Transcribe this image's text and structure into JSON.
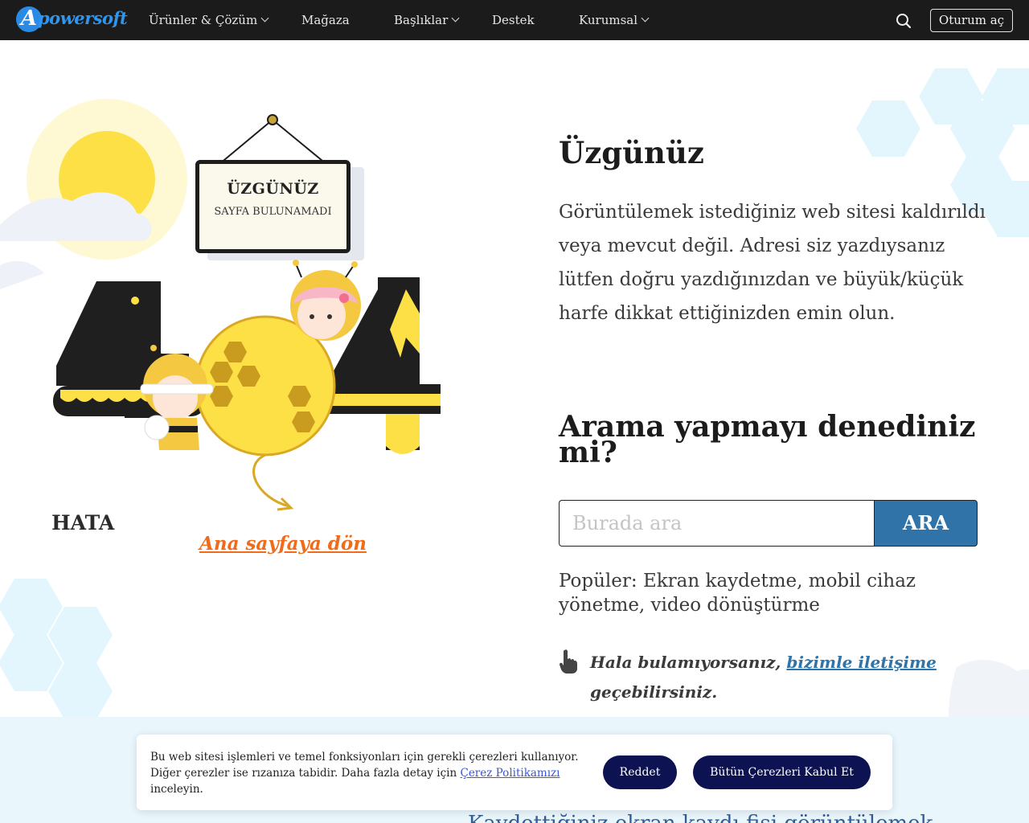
{
  "nav": {
    "logo_text": "powersoft",
    "logo_letter": "A",
    "items": [
      {
        "label": "Ürünler & Çözüm"
      },
      {
        "label": "Mağaza"
      },
      {
        "label": "Başlıklar"
      },
      {
        "label": "Destek"
      },
      {
        "label": "Kurumsal"
      }
    ],
    "login_label": "Oturum aç"
  },
  "illustration": {
    "sign_title": "ÜZGÜNÜZ",
    "sign_subtitle": "SAYFA BULUNAMADI",
    "error_label": "HATA",
    "home_link": "Ana sayfaya dön"
  },
  "main": {
    "sorry_heading": "Üzgünüz",
    "sorry_text": "Görüntülemek istediğiniz web sitesi kaldırıldı veya mevcut değil. Adresi siz yazdıysanız lütfen doğru yazdığınızdan ve büyük/küçük harfe dikkat ettiğinizden emin olun.",
    "search_heading": "Arama yapmayı denediniz mi?",
    "search_placeholder": "Burada ara",
    "search_button": "ARA",
    "popular_text": "Popüler: Ekran kaydetme, mobil cihaz yönetme, video dönüştürme",
    "contact_prefix": "Hala bulamıyorsanız,",
    "contact_link": "bizimle iletişime",
    "contact_suffix": "geçebilirsiniz."
  },
  "bottom": {
    "partial_text": "Kaydettiğiniz ekran kaydı fişi görüntülemek"
  },
  "cookie": {
    "text_before": "Bu web sitesi işlemleri ve temel fonksiyonları için gerekli çerezleri kullanıyor. Diğer çerezler ise rızanıza tabidir. Daha fazla detay için",
    "policy_link": "Çerez Politikamızı",
    "text_after": "inceleyin.",
    "reject_label": "Reddet",
    "accept_label": "Bütün Çerezleri Kabul Et"
  },
  "colors": {
    "nav_bg": "#1b1b1b",
    "logo_blue": "#2f96f0",
    "search_button_bg": "#2f73a8",
    "home_link_orange": "#f06b1a",
    "cookie_button_bg": "#0c1252",
    "bee_yellow": "#fde046",
    "digit_dark": "#1f1f1f",
    "hex_light_blue": "#e3f6fd"
  },
  "icons": [
    "search-icon",
    "chevron-down-icon",
    "hand-pointer-icon"
  ]
}
